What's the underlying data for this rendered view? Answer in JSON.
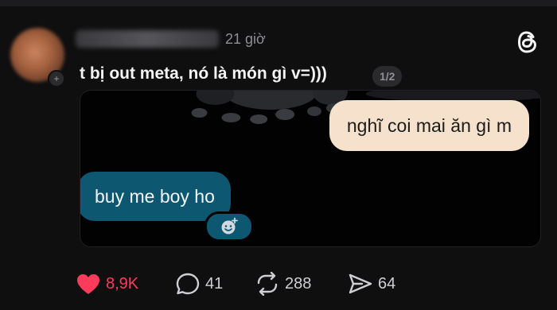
{
  "post": {
    "time": "21 giờ",
    "caption": "t bị out meta, nó là món gì v=)))",
    "page_indicator": "1/2"
  },
  "media": {
    "bubble_right": "nghĩ coi mai ăn gì m",
    "bubble_left": "buy me boy ho"
  },
  "actions": {
    "likes": "8,9K",
    "comments": "41",
    "reposts": "288",
    "shares": "64"
  },
  "colors": {
    "like": "#ff3b5c",
    "bubble_right_bg": "#f6e2cc",
    "bubble_left_bg": "#0e5771",
    "background": "#0f0f10"
  },
  "icons": [
    "threads-logo",
    "heart-icon",
    "comment-icon",
    "repost-icon",
    "share-icon",
    "add-reaction-icon"
  ]
}
